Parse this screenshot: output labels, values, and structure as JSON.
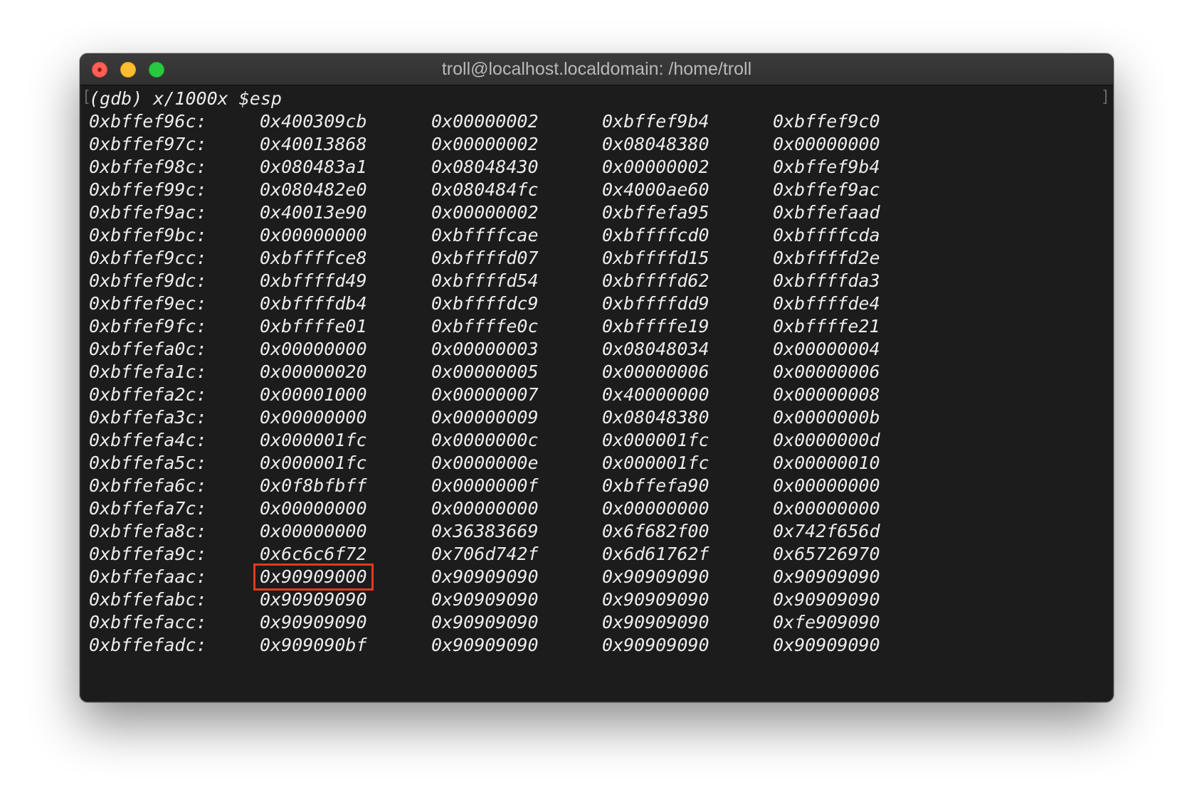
{
  "window": {
    "title": "troll@localhost.localdomain: /home/troll"
  },
  "terminal": {
    "left_bracket": "[",
    "right_bracket": "]",
    "command": "(gdb) x/1000x $esp",
    "highlight_color": "#e23a1e",
    "rows": [
      {
        "addr": "0xbffef96c:",
        "words": [
          "0x400309cb",
          "0x00000002",
          "0xbffef9b4",
          "0xbffef9c0"
        ]
      },
      {
        "addr": "0xbffef97c:",
        "words": [
          "0x40013868",
          "0x00000002",
          "0x08048380",
          "0x00000000"
        ]
      },
      {
        "addr": "0xbffef98c:",
        "words": [
          "0x080483a1",
          "0x08048430",
          "0x00000002",
          "0xbffef9b4"
        ]
      },
      {
        "addr": "0xbffef99c:",
        "words": [
          "0x080482e0",
          "0x080484fc",
          "0x4000ae60",
          "0xbffef9ac"
        ]
      },
      {
        "addr": "0xbffef9ac:",
        "words": [
          "0x40013e90",
          "0x00000002",
          "0xbffefa95",
          "0xbffefaad"
        ]
      },
      {
        "addr": "0xbffef9bc:",
        "words": [
          "0x00000000",
          "0xbffffcae",
          "0xbffffcd0",
          "0xbffffcda"
        ]
      },
      {
        "addr": "0xbffef9cc:",
        "words": [
          "0xbffffce8",
          "0xbffffd07",
          "0xbffffd15",
          "0xbffffd2e"
        ]
      },
      {
        "addr": "0xbffef9dc:",
        "words": [
          "0xbffffd49",
          "0xbffffd54",
          "0xbffffd62",
          "0xbffffda3"
        ]
      },
      {
        "addr": "0xbffef9ec:",
        "words": [
          "0xbffffdb4",
          "0xbffffdc9",
          "0xbffffdd9",
          "0xbffffde4"
        ]
      },
      {
        "addr": "0xbffef9fc:",
        "words": [
          "0xbffffe01",
          "0xbffffe0c",
          "0xbffffe19",
          "0xbffffe21"
        ]
      },
      {
        "addr": "0xbffefa0c:",
        "words": [
          "0x00000000",
          "0x00000003",
          "0x08048034",
          "0x00000004"
        ]
      },
      {
        "addr": "0xbffefa1c:",
        "words": [
          "0x00000020",
          "0x00000005",
          "0x00000006",
          "0x00000006"
        ]
      },
      {
        "addr": "0xbffefa2c:",
        "words": [
          "0x00001000",
          "0x00000007",
          "0x40000000",
          "0x00000008"
        ]
      },
      {
        "addr": "0xbffefa3c:",
        "words": [
          "0x00000000",
          "0x00000009",
          "0x08048380",
          "0x0000000b"
        ]
      },
      {
        "addr": "0xbffefa4c:",
        "words": [
          "0x000001fc",
          "0x0000000c",
          "0x000001fc",
          "0x0000000d"
        ]
      },
      {
        "addr": "0xbffefa5c:",
        "words": [
          "0x000001fc",
          "0x0000000e",
          "0x000001fc",
          "0x00000010"
        ]
      },
      {
        "addr": "0xbffefa6c:",
        "words": [
          "0x0f8bfbff",
          "0x0000000f",
          "0xbffefa90",
          "0x00000000"
        ]
      },
      {
        "addr": "0xbffefa7c:",
        "words": [
          "0x00000000",
          "0x00000000",
          "0x00000000",
          "0x00000000"
        ]
      },
      {
        "addr": "0xbffefa8c:",
        "words": [
          "0x00000000",
          "0x36383669",
          "0x6f682f00",
          "0x742f656d"
        ]
      },
      {
        "addr": "0xbffefa9c:",
        "words": [
          "0x6c6c6f72",
          "0x706d742f",
          "0x6d61762f",
          "0x65726970"
        ]
      },
      {
        "addr": "0xbffefaac:",
        "words": [
          "0x90909000",
          "0x90909090",
          "0x90909090",
          "0x90909090"
        ],
        "highlight": 0
      },
      {
        "addr": "0xbffefabc:",
        "words": [
          "0x90909090",
          "0x90909090",
          "0x90909090",
          "0x90909090"
        ]
      },
      {
        "addr": "0xbffefacc:",
        "words": [
          "0x90909090",
          "0x90909090",
          "0x90909090",
          "0xfe909090"
        ]
      },
      {
        "addr": "0xbffefadc:",
        "words": [
          "0x909090bf",
          "0x90909090",
          "0x90909090",
          "0x90909090"
        ]
      }
    ]
  }
}
